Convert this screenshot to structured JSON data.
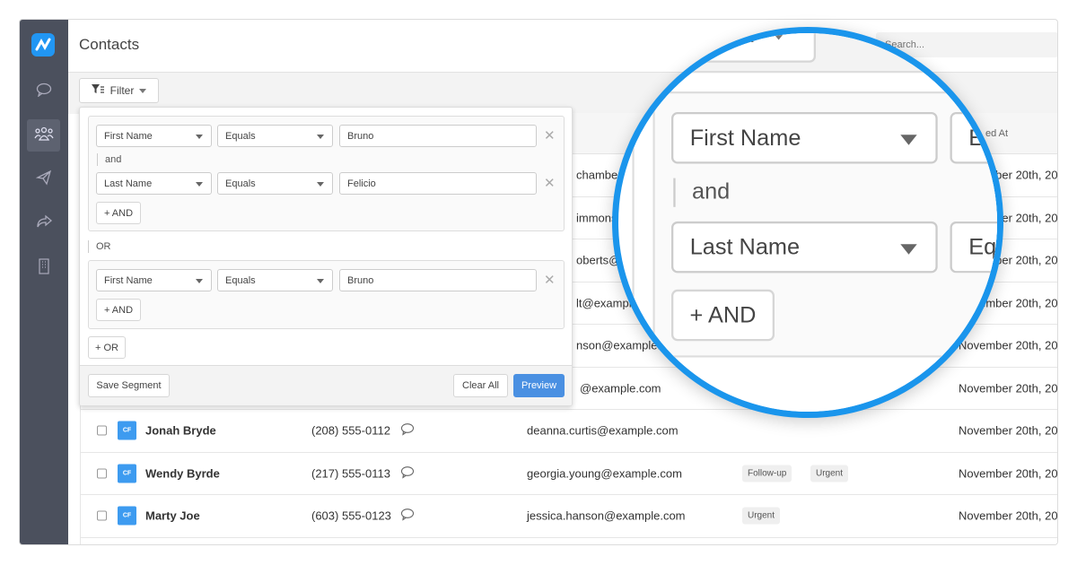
{
  "app": {
    "title": "Contacts",
    "search_placeholder": "Search...",
    "accent": "#1a95ec"
  },
  "sidebar": {
    "items": [
      {
        "icon": "chat-icon"
      },
      {
        "icon": "users-icon",
        "active": true
      },
      {
        "icon": "send-icon"
      },
      {
        "icon": "share-icon"
      },
      {
        "icon": "building-icon"
      }
    ]
  },
  "toolbar": {
    "filter_label": "Filter"
  },
  "table": {
    "date_header_fragment": "ed At",
    "rows": [
      {
        "email": "chambers",
        "date": "November 20th, 20"
      },
      {
        "email": "immons",
        "date": "November 20th, 20"
      },
      {
        "email": "oberts@e",
        "date": "November 20th, 20"
      },
      {
        "email": "lt@example",
        "date": "November 20th, 20"
      },
      {
        "email": "nson@example.com",
        "date": "November 20th, 20"
      },
      {
        "email": "@example.com",
        "date": "November 20th, 20"
      },
      {
        "initials": "CF",
        "name": "Jonah Bryde",
        "phone": "(208) 555-0112",
        "email": "deanna.curtis@example.com",
        "tags": [],
        "date": "November 20th, 20"
      },
      {
        "initials": "CF",
        "name": "Wendy Byrde",
        "phone": "(217) 555-0113",
        "email": "georgia.young@example.com",
        "tags": [
          "Follow-up",
          "Urgent"
        ],
        "date": "November 20th, 20"
      },
      {
        "initials": "CF",
        "name": "Marty Joe",
        "phone": "(603) 555-0123",
        "email": "jessica.hanson@example.com",
        "tags": [
          "Urgent"
        ],
        "date": "November 20th, 20"
      }
    ]
  },
  "filter": {
    "groups": [
      {
        "conditions": [
          {
            "field": "First Name",
            "op": "Equals",
            "value": "Bruno"
          },
          {
            "field": "Last Name",
            "op": "Equals",
            "value": "Felicio"
          }
        ],
        "conjunction": "and",
        "add_and": "+ AND"
      },
      {
        "conditions": [
          {
            "field": "First Name",
            "op": "Equals",
            "value": "Bruno"
          }
        ],
        "add_and": "+ AND"
      }
    ],
    "or_label": "OR",
    "add_or": "+ OR",
    "save_segment": "Save Segment",
    "clear_all": "Clear All",
    "preview": "Preview",
    "preview_color": "#4a90e2"
  }
}
